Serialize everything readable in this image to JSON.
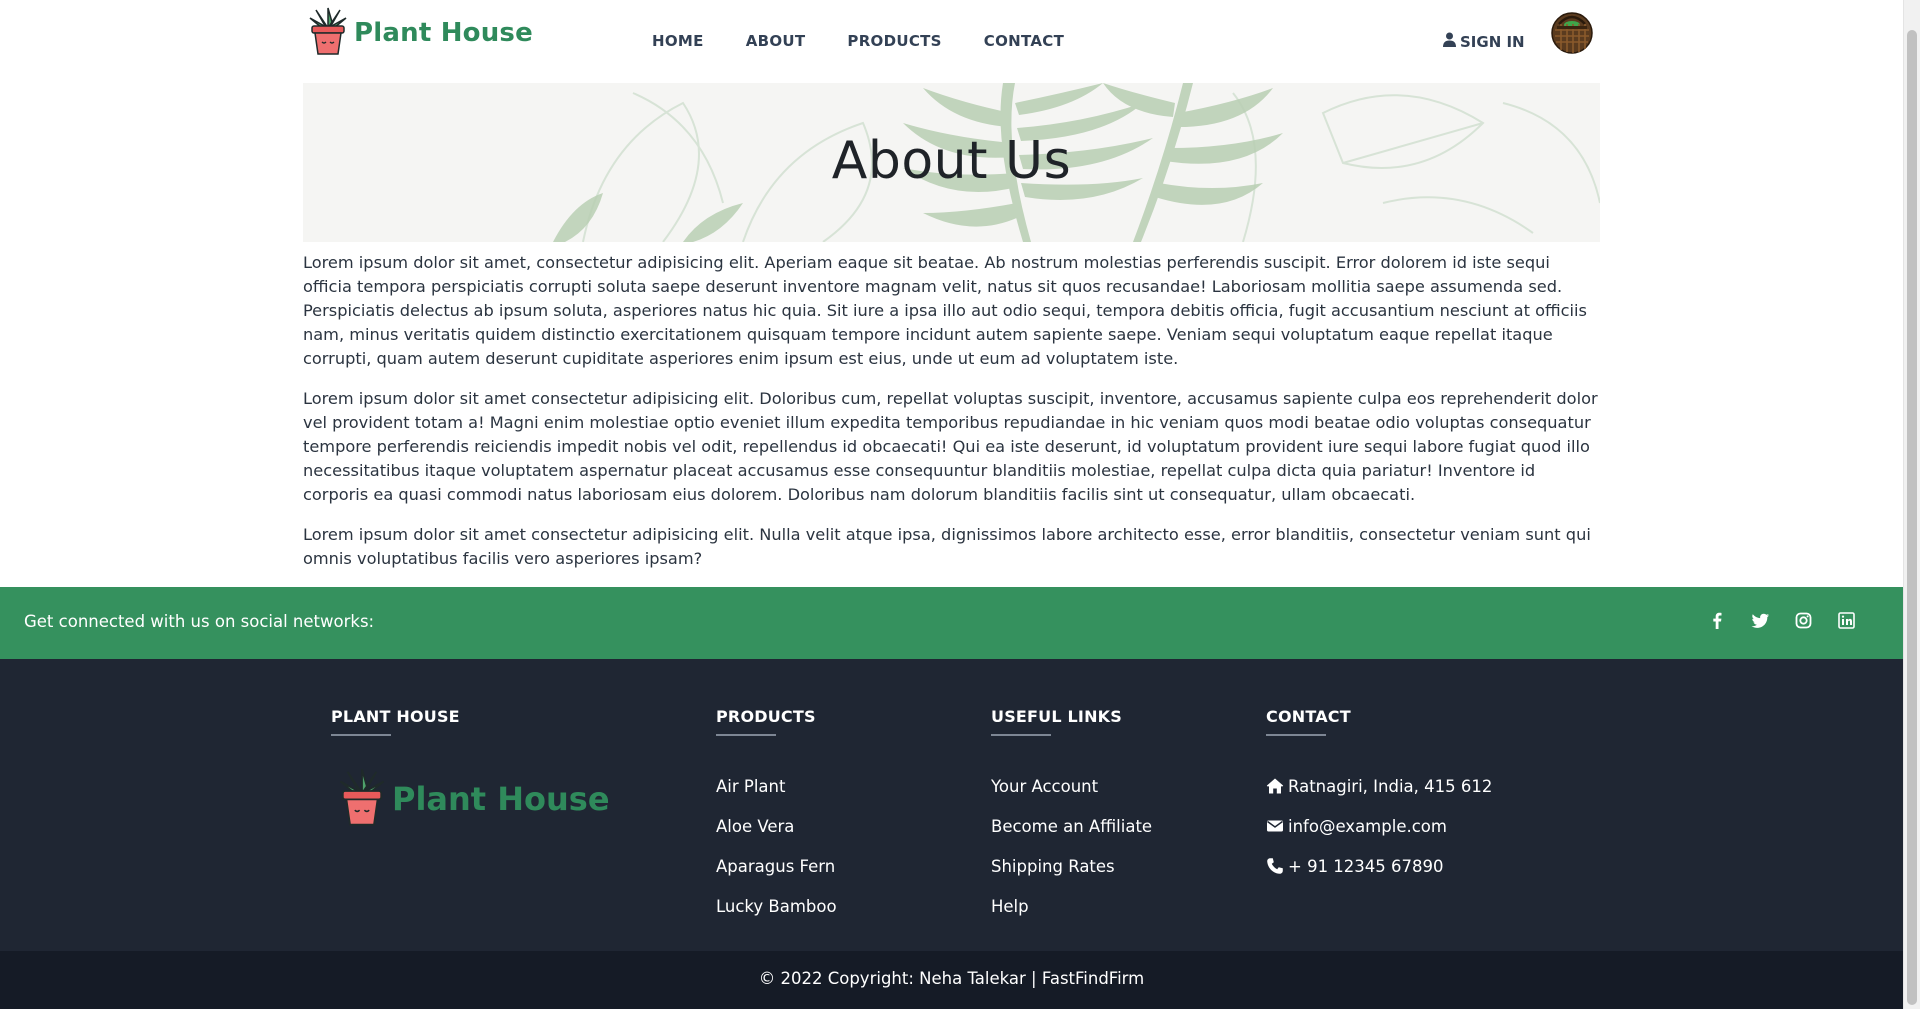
{
  "navbar": {
    "brand": "Plant House",
    "links": [
      "HOME",
      "ABOUT",
      "PRODUCTS",
      "CONTACT"
    ],
    "signin": "SIGN IN"
  },
  "hero": {
    "title": "About Us"
  },
  "content": {
    "paragraphs": [
      "Lorem ipsum dolor sit amet, consectetur adipisicing elit. Aperiam eaque sit beatae. Ab nostrum molestias perferendis suscipit. Error dolorem id iste sequi officia tempora perspiciatis corrupti soluta saepe deserunt inventore magnam velit, natus sit quos recusandae! Laboriosam mollitia saepe assumenda sed. Perspiciatis delectus ab ipsum soluta, asperiores natus hic quia. Sit iure a ipsa illo aut odio sequi, tempora debitis officia, fugit accusantium nesciunt at officiis nam, minus veritatis quidem distinctio exercitationem quisquam tempore incidunt autem sapiente saepe. Veniam sequi voluptatum eaque repellat itaque corrupti, quam autem deserunt cupiditate asperiores enim ipsum est eius, unde ut eum ad voluptatem iste.",
      "Lorem ipsum dolor sit amet consectetur adipisicing elit. Doloribus cum, repellat voluptas suscipit, inventore, accusamus sapiente culpa eos reprehenderit dolor vel provident totam a! Magni enim molestiae optio eveniet illum expedita temporibus repudiandae in hic veniam quos modi beatae odio voluptas consequatur tempore perferendis reiciendis impedit nobis vel odit, repellendus id obcaecati! Qui ea iste deserunt, id voluptatum provident iure sequi labore fugiat quod illo necessitatibus itaque voluptatem aspernatur placeat accusamus esse consequuntur blanditiis molestiae, repellat culpa dicta quia pariatur! Inventore id corporis ea quasi commodi natus laboriosam eius dolorem. Doloribus nam dolorum blanditiis facilis sint ut consequatur, ullam obcaecati.",
      "Lorem ipsum dolor sit amet consectetur adipisicing elit. Nulla velit atque ipsa, dignissimos labore architecto esse, error blanditiis, consectetur veniam sunt qui omnis voluptatibus facilis vero asperiores ipsam?"
    ]
  },
  "social": {
    "text": "Get connected with us on social networks:",
    "icons": [
      "facebook-icon",
      "twitter-icon",
      "instagram-icon",
      "linkedin-icon"
    ]
  },
  "footer": {
    "about": {
      "heading": "PLANT HOUSE",
      "logo_text": "Plant House"
    },
    "products": {
      "heading": "PRODUCTS",
      "items": [
        "Air Plant",
        "Aloe Vera",
        "Aparagus Fern",
        "Lucky Bamboo"
      ]
    },
    "useful_links": {
      "heading": "USEFUL LINKS",
      "items": [
        "Your Account",
        "Become an Affiliate",
        "Shipping Rates",
        "Help"
      ]
    },
    "contact": {
      "heading": "CONTACT",
      "address": "Ratnagiri, India, 415 612",
      "email": "info@example.com",
      "phone": "+ 91 12345 67890"
    }
  },
  "copyright": "© 2022 Copyright: Neha Talekar | FastFindFirm",
  "colors": {
    "brand_green": "#2f8a5b",
    "social_bar": "#35915e",
    "footer_bg": "#1f2633",
    "copyright_bg": "#151b26"
  }
}
